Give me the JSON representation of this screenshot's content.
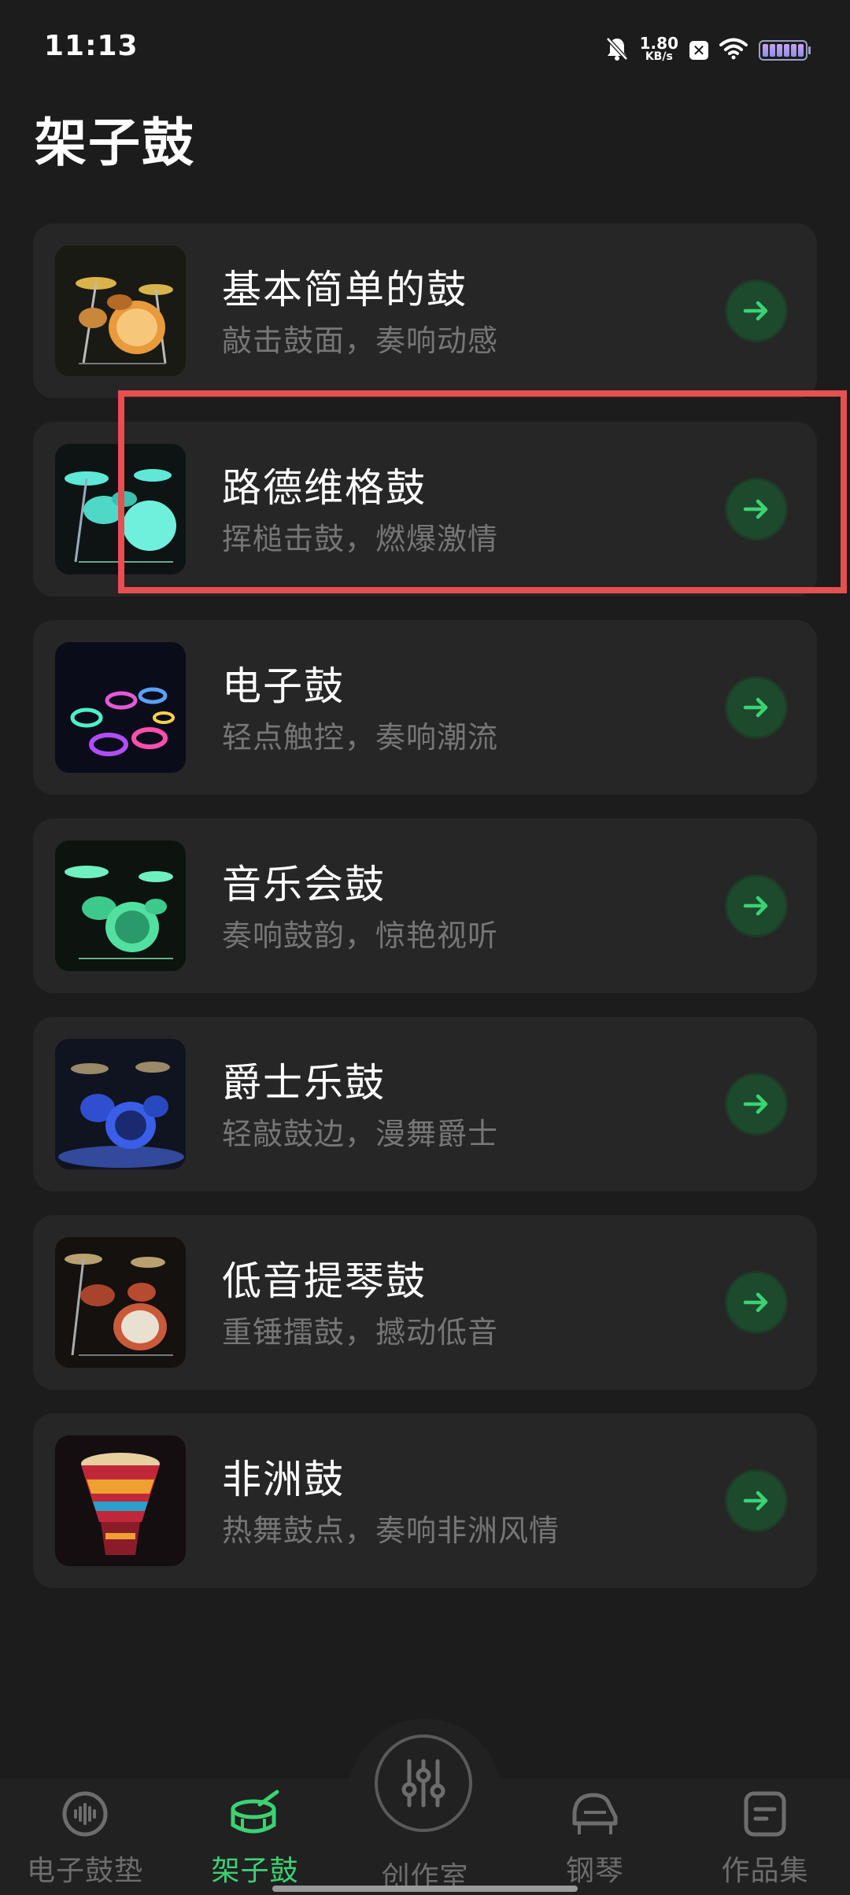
{
  "status_bar": {
    "time": "11:13",
    "net_speed_value": "1.80",
    "net_speed_unit": "KB/s",
    "icons": [
      "bell-muted-icon",
      "network-speed",
      "x-badge-icon",
      "wifi-icon",
      "battery-icon"
    ]
  },
  "page": {
    "title": "架子鼓"
  },
  "drums": [
    {
      "title": "基本简单的鼓",
      "subtitle": "敲击鼓面，奏响动感",
      "thumb": "drum-kit-orange",
      "action_icon": "arrow-right-icon"
    },
    {
      "title": "路德维格鼓",
      "subtitle": "挥槌击鼓，燃爆激情",
      "thumb": "drum-kit-cyan",
      "action_icon": "arrow-right-icon"
    },
    {
      "title": "电子鼓",
      "subtitle": "轻点触控，奏响潮流",
      "thumb": "electronic-drum-pads",
      "action_icon": "arrow-right-icon"
    },
    {
      "title": "音乐会鼓",
      "subtitle": "奏响鼓韵，惊艳视听",
      "thumb": "drum-kit-green",
      "action_icon": "arrow-right-icon"
    },
    {
      "title": "爵士乐鼓",
      "subtitle": "轻敲鼓边，漫舞爵士",
      "thumb": "drum-kit-blue",
      "action_icon": "arrow-right-icon"
    },
    {
      "title": "低音提琴鼓",
      "subtitle": "重锤擂鼓，撼动低音",
      "thumb": "drum-kit-red",
      "action_icon": "arrow-right-icon"
    },
    {
      "title": "非洲鼓",
      "subtitle": "热舞鼓点，奏响非洲风情",
      "thumb": "djembe-drum",
      "action_icon": "arrow-right-icon"
    }
  ],
  "tabbar": {
    "tabs": [
      {
        "label": "电子鼓垫",
        "icon": "drum-pad-icon",
        "active": false
      },
      {
        "label": "架子鼓",
        "icon": "drum-icon",
        "active": true
      },
      {
        "label": "创作室",
        "icon": "mixer-sliders-icon",
        "active": false
      },
      {
        "label": "钢琴",
        "icon": "piano-icon",
        "active": false
      },
      {
        "label": "作品集",
        "icon": "document-icon",
        "active": false
      }
    ]
  },
  "colors": {
    "background": "#1c1c1c",
    "card": "#262626",
    "accent_green": "#3cd273",
    "highlight_red": "#e65050",
    "subtitle_gray": "#767676"
  }
}
